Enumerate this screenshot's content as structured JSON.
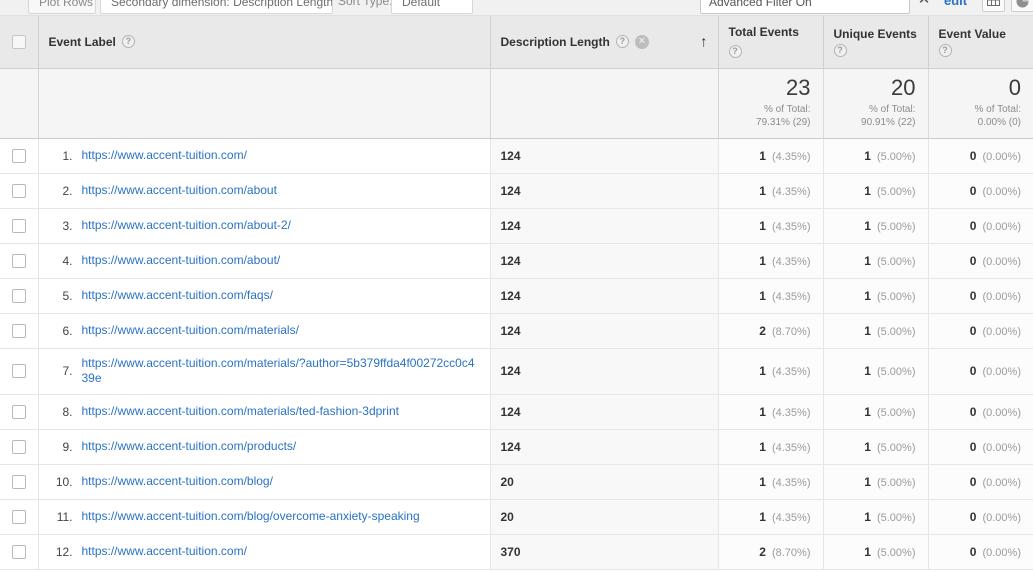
{
  "toolbar": {
    "plot_rows_label": "Plot Rows",
    "secondary_dimension_label": "Secondary dimension: Description Length",
    "sort_type_label": "Sort Type:",
    "sort_type_value": "Default",
    "advanced_filter_label": "Advanced Filter On",
    "close_filter_icon": "✕",
    "edit_label": "edit",
    "table_view_icon": "table-view",
    "pie_view_icon": "pie-view"
  },
  "table": {
    "select_all_label": "",
    "columns": [
      {
        "key": "event_label",
        "label": "Event Label",
        "help": "?"
      },
      {
        "key": "description_length",
        "label": "Description Length",
        "help": "?",
        "remove": "✕",
        "sort": "↑"
      },
      {
        "key": "total_events",
        "label": "Total Events",
        "help": "?"
      },
      {
        "key": "unique_events",
        "label": "Unique Events",
        "help": "?"
      },
      {
        "key": "event_value",
        "label": "Event Value",
        "help": "?"
      }
    ],
    "summary": {
      "total_events": {
        "value": "23",
        "of_total_label": "% of Total:",
        "of_total_value": "79.31% (29)"
      },
      "unique_events": {
        "value": "20",
        "of_total_label": "% of Total:",
        "of_total_value": "90.91% (22)"
      },
      "event_value": {
        "value": "0",
        "of_total_label": "% of Total:",
        "of_total_value": "0.00% (0)"
      }
    },
    "rows": [
      {
        "index": "1.",
        "event_label": "https://www.accent-tuition.com/",
        "description_length": "124",
        "total_events": "1",
        "total_events_pct": "(4.35%)",
        "unique_events": "1",
        "unique_events_pct": "(5.00%)",
        "event_value": "0",
        "event_value_pct": "(0.00%)"
      },
      {
        "index": "2.",
        "event_label": "https://www.accent-tuition.com/about",
        "description_length": "124",
        "total_events": "1",
        "total_events_pct": "(4.35%)",
        "unique_events": "1",
        "unique_events_pct": "(5.00%)",
        "event_value": "0",
        "event_value_pct": "(0.00%)"
      },
      {
        "index": "3.",
        "event_label": "https://www.accent-tuition.com/about-2/",
        "description_length": "124",
        "total_events": "1",
        "total_events_pct": "(4.35%)",
        "unique_events": "1",
        "unique_events_pct": "(5.00%)",
        "event_value": "0",
        "event_value_pct": "(0.00%)"
      },
      {
        "index": "4.",
        "event_label": "https://www.accent-tuition.com/about/",
        "description_length": "124",
        "total_events": "1",
        "total_events_pct": "(4.35%)",
        "unique_events": "1",
        "unique_events_pct": "(5.00%)",
        "event_value": "0",
        "event_value_pct": "(0.00%)"
      },
      {
        "index": "5.",
        "event_label": "https://www.accent-tuition.com/faqs/",
        "description_length": "124",
        "total_events": "1",
        "total_events_pct": "(4.35%)",
        "unique_events": "1",
        "unique_events_pct": "(5.00%)",
        "event_value": "0",
        "event_value_pct": "(0.00%)"
      },
      {
        "index": "6.",
        "event_label": "https://www.accent-tuition.com/materials/",
        "description_length": "124",
        "total_events": "2",
        "total_events_pct": "(8.70%)",
        "unique_events": "1",
        "unique_events_pct": "(5.00%)",
        "event_value": "0",
        "event_value_pct": "(0.00%)"
      },
      {
        "index": "7.",
        "event_label": "https://www.accent-tuition.com/materials/?author=5b379ffda4f00272cc0c439e",
        "description_length": "124",
        "total_events": "1",
        "total_events_pct": "(4.35%)",
        "unique_events": "1",
        "unique_events_pct": "(5.00%)",
        "event_value": "0",
        "event_value_pct": "(0.00%)",
        "tall": true
      },
      {
        "index": "8.",
        "event_label": "https://www.accent-tuition.com/materials/ted-fashion-3dprint",
        "description_length": "124",
        "total_events": "1",
        "total_events_pct": "(4.35%)",
        "unique_events": "1",
        "unique_events_pct": "(5.00%)",
        "event_value": "0",
        "event_value_pct": "(0.00%)"
      },
      {
        "index": "9.",
        "event_label": "https://www.accent-tuition.com/products/",
        "description_length": "124",
        "total_events": "1",
        "total_events_pct": "(4.35%)",
        "unique_events": "1",
        "unique_events_pct": "(5.00%)",
        "event_value": "0",
        "event_value_pct": "(0.00%)"
      },
      {
        "index": "10.",
        "event_label": "https://www.accent-tuition.com/blog/",
        "description_length": "20",
        "total_events": "1",
        "total_events_pct": "(4.35%)",
        "unique_events": "1",
        "unique_events_pct": "(5.00%)",
        "event_value": "0",
        "event_value_pct": "(0.00%)"
      },
      {
        "index": "11.",
        "event_label": "https://www.accent-tuition.com/blog/overcome-anxiety-speaking",
        "description_length": "20",
        "total_events": "1",
        "total_events_pct": "(4.35%)",
        "unique_events": "1",
        "unique_events_pct": "(5.00%)",
        "event_value": "0",
        "event_value_pct": "(0.00%)"
      },
      {
        "index": "12.",
        "event_label": "https://www.accent-tuition.com/",
        "description_length": "370",
        "total_events": "2",
        "total_events_pct": "(8.70%)",
        "unique_events": "1",
        "unique_events_pct": "(5.00%)",
        "event_value": "0",
        "event_value_pct": "(0.00%)"
      }
    ]
  },
  "colors": {
    "link": "#2a72c5",
    "header_bg": "#e9e9e9",
    "summary_bg": "#f5f5f5",
    "desc_col_bg": "#f8f8f8"
  }
}
